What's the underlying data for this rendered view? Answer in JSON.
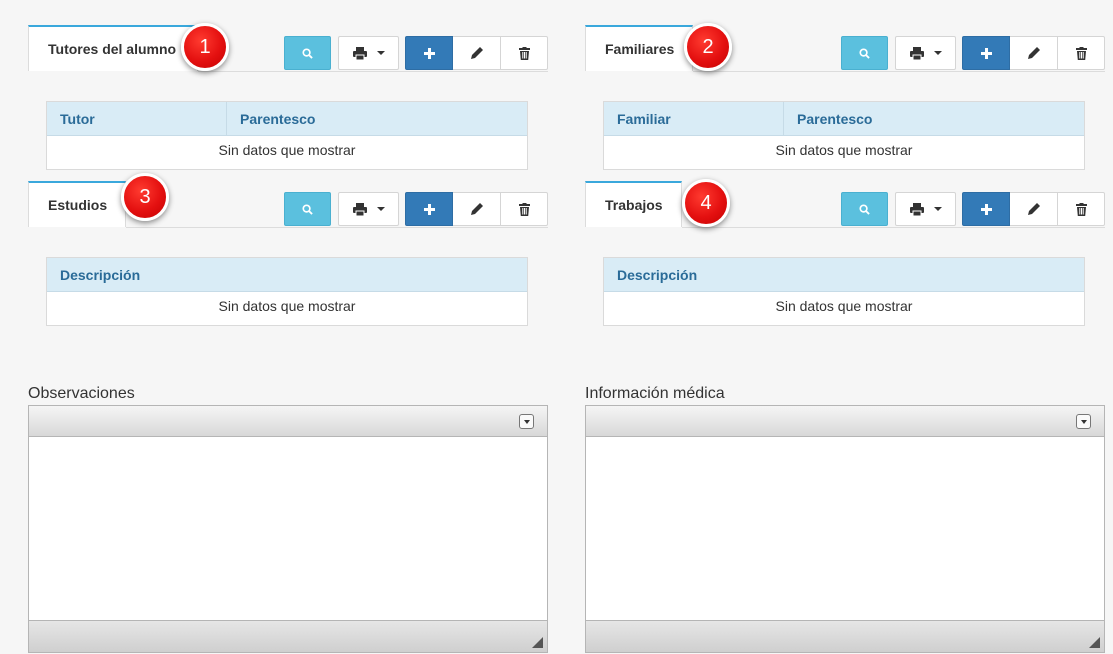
{
  "panels": [
    {
      "tab": "Tutores del alumno",
      "badge": "1",
      "columns": [
        "Tutor",
        "Parentesco"
      ],
      "empty": "Sin datos que mostrar"
    },
    {
      "tab": "Familiares",
      "badge": "2",
      "columns": [
        "Familiar",
        "Parentesco"
      ],
      "empty": "Sin datos que mostrar"
    },
    {
      "tab": "Estudios",
      "badge": "3",
      "columns": [
        "Descripción"
      ],
      "empty": "Sin datos que mostrar"
    },
    {
      "tab": "Trabajos",
      "badge": "4",
      "columns": [
        "Descripción"
      ],
      "empty": "Sin datos que mostrar"
    }
  ],
  "toolbar_icons": [
    "search-icon",
    "print-icon",
    "plus-icon",
    "pencil-icon",
    "trash-icon"
  ],
  "editors": [
    {
      "label": "Observaciones"
    },
    {
      "label": "Información médica"
    }
  ],
  "colors": {
    "search_button": "#5bc0de",
    "add_button": "#337ab7",
    "tab_accent": "#3aa8dc",
    "grid_header": "#d9ecf6",
    "grid_header_text": "#2a6b98",
    "badge": "#e41010"
  }
}
